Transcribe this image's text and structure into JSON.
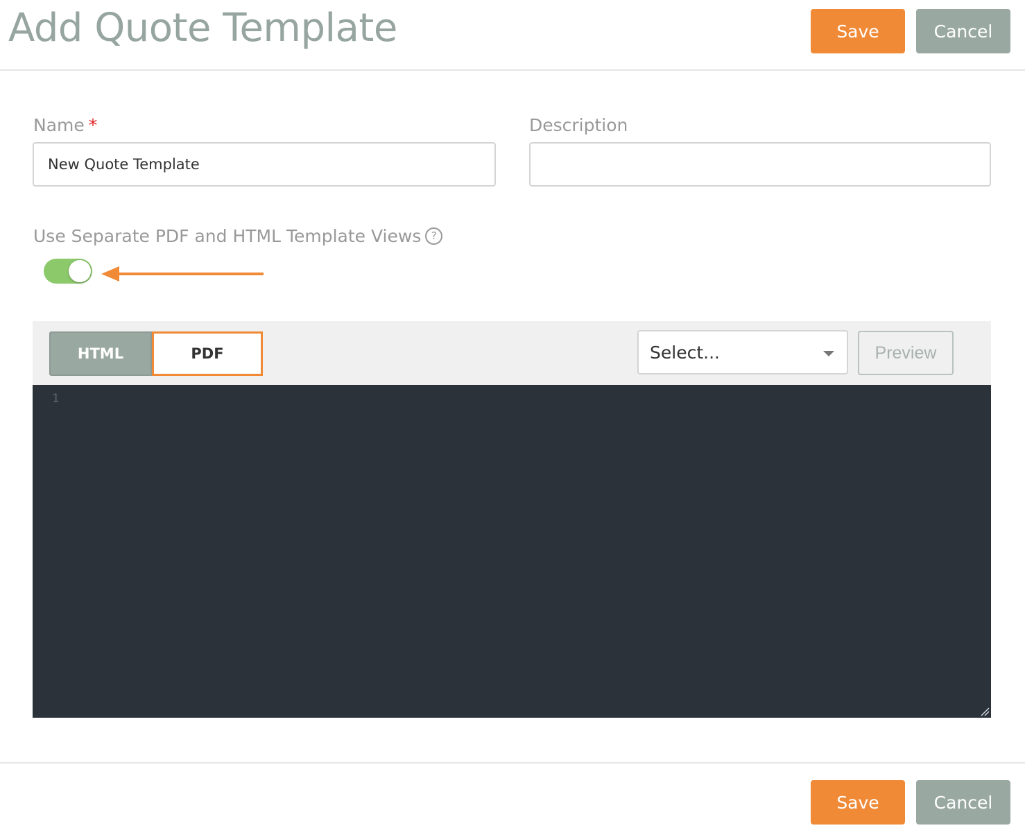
{
  "header": {
    "title": "Add Quote Template",
    "save_label": "Save",
    "cancel_label": "Cancel"
  },
  "form": {
    "name": {
      "label": "Name",
      "required_marker": "*",
      "value": "New Quote Template"
    },
    "description": {
      "label": "Description",
      "value": ""
    },
    "separate_views": {
      "label": "Use Separate PDF and HTML Template Views",
      "help_glyph": "?",
      "enabled": true
    }
  },
  "editor": {
    "tabs": [
      {
        "label": "HTML",
        "active": false
      },
      {
        "label": "PDF",
        "active": true
      }
    ],
    "select": {
      "value": "Select..."
    },
    "preview_label": "Preview",
    "line_numbers": [
      "1"
    ]
  },
  "footer": {
    "save_label": "Save",
    "cancel_label": "Cancel"
  },
  "colors": {
    "accent": "#f08a37",
    "secondary": "#9aa8a2",
    "toggle_on": "#8cc96b",
    "editor_bg": "#2b323a"
  }
}
